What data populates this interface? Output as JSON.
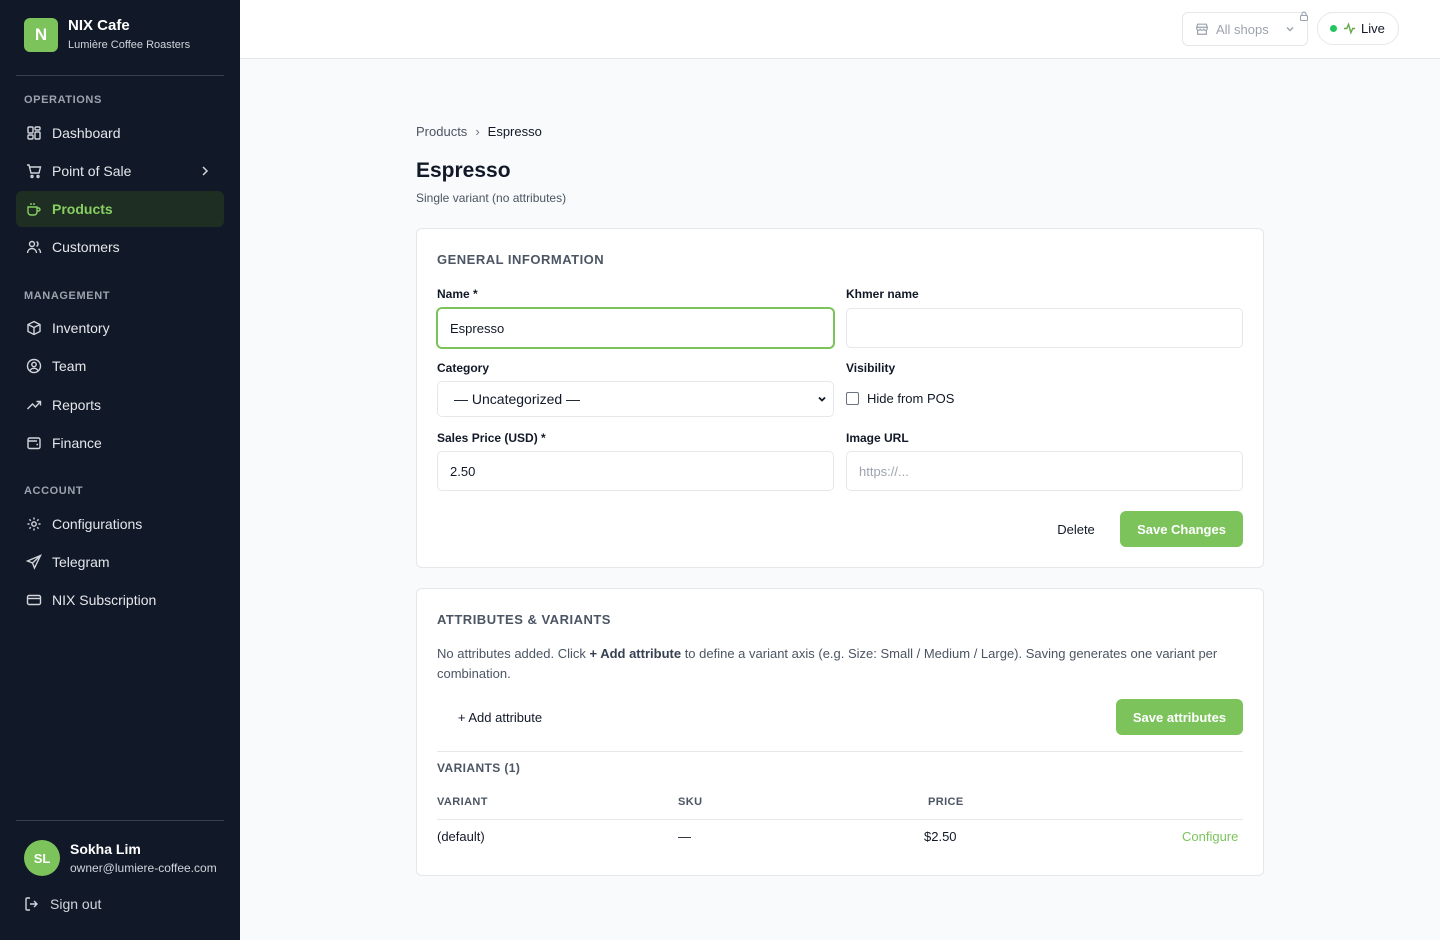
{
  "brand": {
    "initial": "N",
    "name": "NIX Cafe",
    "subtitle": "Lumière Coffee Roasters"
  },
  "sidebar": {
    "sections": [
      {
        "title": "OPERATIONS",
        "items": [
          {
            "label": "Dashboard",
            "icon": "dashboard-icon"
          },
          {
            "label": "Point of Sale",
            "icon": "cart-icon"
          },
          {
            "label": "Products",
            "icon": "coffee-cup-icon",
            "active": true
          },
          {
            "label": "Customers",
            "icon": "users-icon"
          }
        ]
      },
      {
        "title": "MANAGEMENT",
        "items": [
          {
            "label": "Inventory",
            "icon": "box-icon"
          },
          {
            "label": "Team",
            "icon": "user-circle-icon"
          },
          {
            "label": "Reports",
            "icon": "trend-icon"
          },
          {
            "label": "Finance",
            "icon": "wallet-icon"
          }
        ]
      },
      {
        "title": "ACCOUNT",
        "items": [
          {
            "label": "Configurations",
            "icon": "gear-icon"
          },
          {
            "label": "Telegram",
            "icon": "send-icon"
          },
          {
            "label": "NIX Subscription",
            "icon": "credit-card-icon"
          }
        ]
      }
    ]
  },
  "user": {
    "initials": "SL",
    "name": "Sokha Lim",
    "email": "owner@lumiere-coffee.com",
    "signout": "Sign out"
  },
  "topbar": {
    "shop_label": "All shops",
    "live_label": "Live"
  },
  "breadcrumb": {
    "parent": "Products",
    "current": "Espresso"
  },
  "page": {
    "title": "Espresso",
    "subtitle": "Single variant (no attributes)"
  },
  "general": {
    "title": "GENERAL INFORMATION",
    "name_label": "Name *",
    "name_value": "Espresso",
    "khmer_label": "Khmer name",
    "khmer_value": "",
    "category_label": "Category",
    "category_value": "— Uncategorized —",
    "visibility_label": "Visibility",
    "hide_label": "Hide from POS",
    "hide_checked": false,
    "price_label": "Sales Price (USD) *",
    "price_value": "2.50",
    "image_label": "Image URL",
    "image_placeholder": "https://...",
    "delete_label": "Delete",
    "save_label": "Save Changes"
  },
  "attributes": {
    "title": "ATTRIBUTES & VARIANTS",
    "desc_before": "No attributes added. Click ",
    "desc_bold": "+ Add attribute",
    "desc_after": " to define a variant axis (e.g. Size: Small / Medium / Large). Saving generates one variant per combination.",
    "add_label": "+ Add attribute",
    "save_label": "Save attributes",
    "variants_title": "VARIANTS (1)",
    "columns": [
      "VARIANT",
      "SKU",
      "PRICE"
    ],
    "rows": [
      {
        "variant": "(default)",
        "sku": "—",
        "price": "$2.50",
        "action": "Configure"
      }
    ]
  },
  "colors": {
    "accent": "#7cc35c",
    "sidebar_bg": "#111827"
  }
}
